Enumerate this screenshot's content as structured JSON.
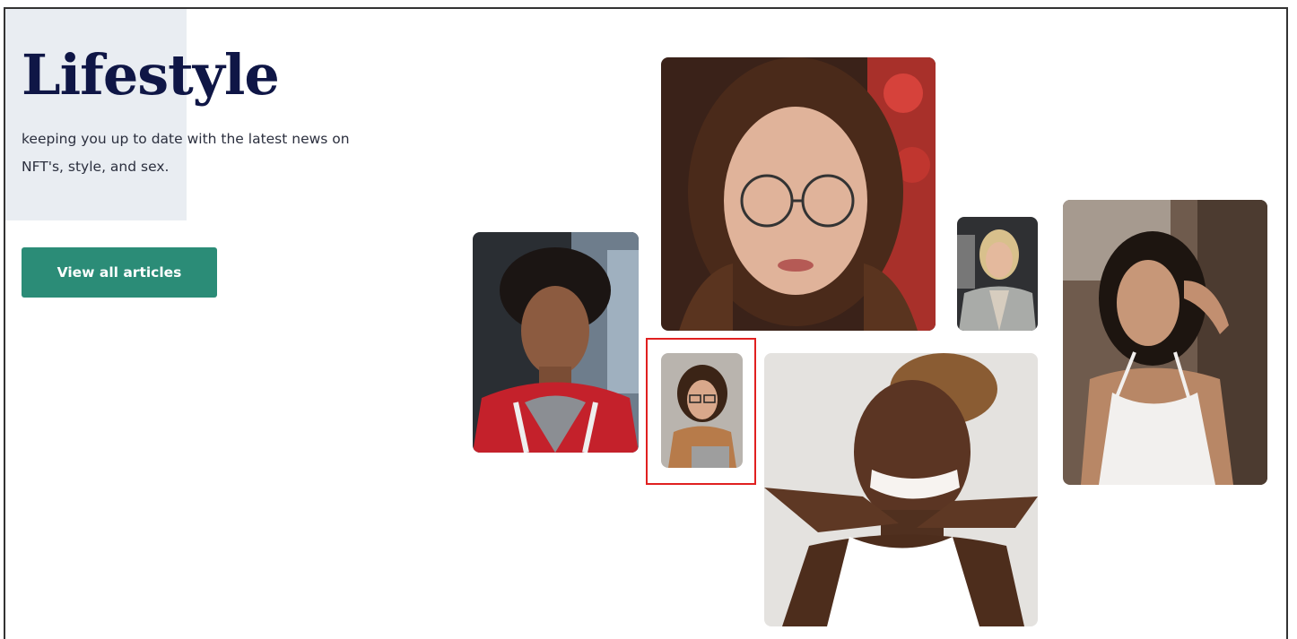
{
  "hero": {
    "title": "Lifestyle",
    "subtitle_line1": "keeping you up to date with the latest news on",
    "subtitle_line2": "NFT's, style, and sex.",
    "cta_label": "View all articles"
  },
  "gallery": {
    "photos": [
      {
        "name": "photo-man-red-jacket",
        "bg": "#5b6a78",
        "accent": "#c4212b"
      },
      {
        "name": "photo-woman-glasses-large",
        "bg": "#4a2a1e",
        "accent": "#b8332c"
      },
      {
        "name": "photo-woman-laptop-small",
        "bg": "#b7b2ad",
        "accent": "#b77b4a"
      },
      {
        "name": "photo-older-woman-suit",
        "bg": "#3a3a3a",
        "accent": "#b9bbb8"
      },
      {
        "name": "photo-woman-white-top",
        "bg": "#e6e4e1",
        "accent": "#ffffff"
      },
      {
        "name": "photo-woman-white-dress",
        "bg": "#8a7566",
        "accent": "#f2f0ee"
      }
    ]
  },
  "colors": {
    "title": "#0f1646",
    "button": "#2b8c77",
    "highlight": "#e02020"
  }
}
